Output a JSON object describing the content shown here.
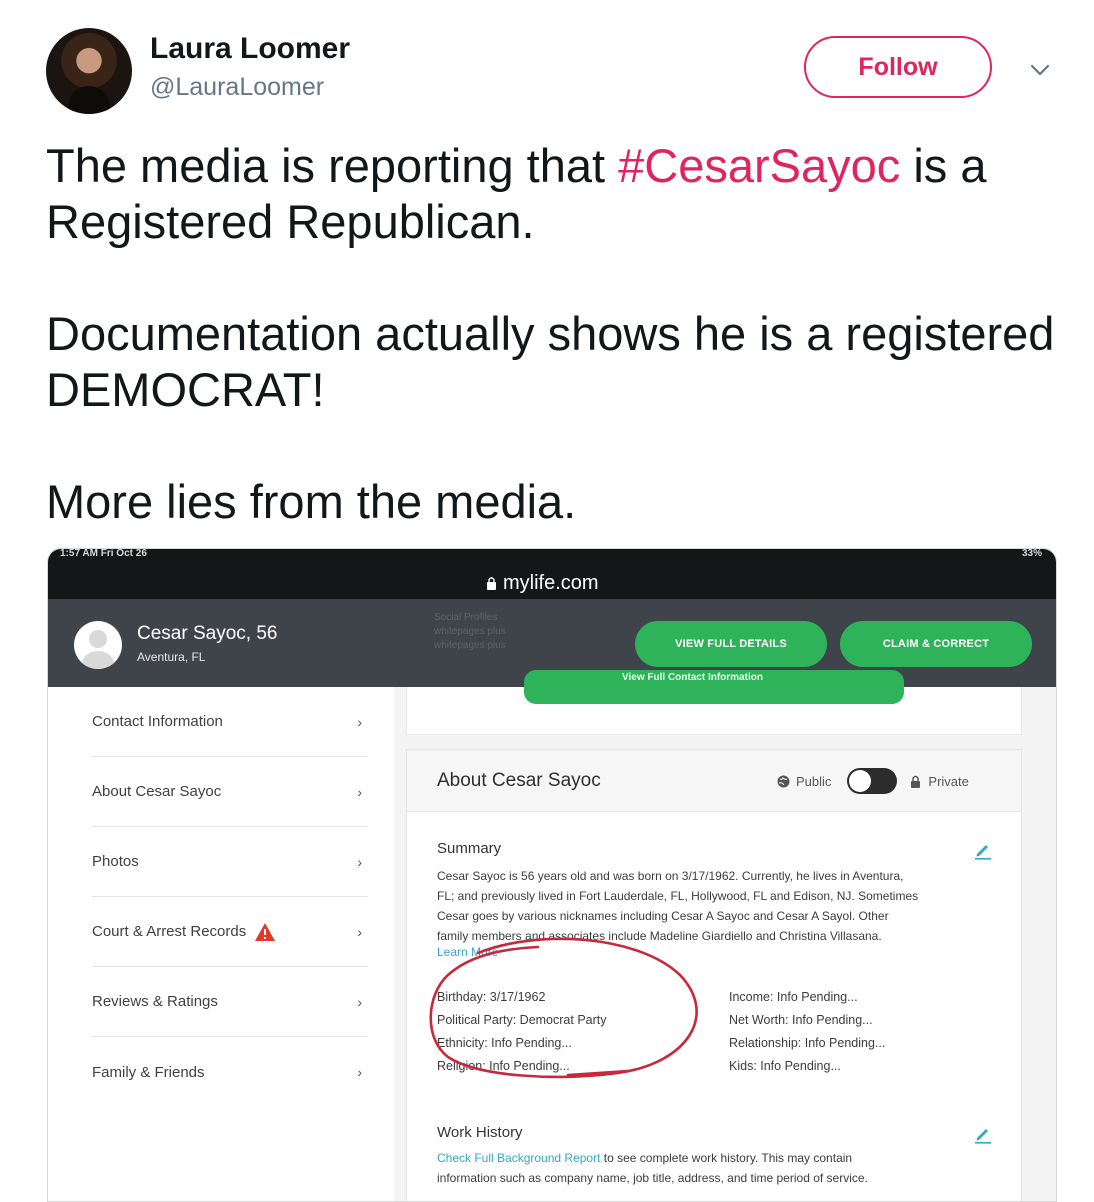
{
  "tweet": {
    "author_name": "Laura Loomer",
    "author_handle": "@LauraLoomer",
    "follow_label": "Follow",
    "text_line1_pre": "The media is reporting that ",
    "hashtag": "#CesarSayoc",
    "text_line1_post": " is a Registered Republican.",
    "text_para2": "Documentation actually shows he is a registered DEMOCRAT!",
    "text_para3": "More lies from the media."
  },
  "screenshot": {
    "status_left": "1:57 AM  Fri Oct 26",
    "status_right": "33%",
    "url": "mylife.com",
    "profile": {
      "name": "Cesar Sayoc, 56",
      "location": "Aventura, FL",
      "ghost_lines": [
        "Social Profiles",
        "whitepages plus",
        "whitepages plus"
      ]
    },
    "buttons": {
      "view_full_details": "VIEW FULL DETAILS",
      "claim_correct": "CLAIM & CORRECT",
      "view_contact": "View Full Contact Information"
    },
    "nav": [
      {
        "label": "Contact Information"
      },
      {
        "label": "About Cesar Sayoc"
      },
      {
        "label": "Photos"
      },
      {
        "label": "Court & Arrest Records"
      },
      {
        "label": "Reviews & Ratings"
      },
      {
        "label": "Family & Friends"
      }
    ],
    "nav_chevron": "›",
    "about": {
      "title": "About Cesar Sayoc",
      "public_label": "Public",
      "private_label": "Private",
      "summary_title": "Summary",
      "summary_lines": [
        "Cesar Sayoc is 56 years old and was born on 3/17/1962. Currently, he lives in Aventura,",
        "FL; and previously lived in Fort Lauderdale, FL, Hollywood, FL and Edison, NJ. Sometimes",
        "Cesar goes by various nicknames including Cesar A Sayoc and Cesar A Sayol. Other",
        "family members and associates include Madeline Giardiello and Christina Villasana."
      ],
      "learn_more": "Learn More",
      "facts_left": [
        "Birthday: 3/17/1962",
        "Political Party: Democrat Party",
        "Ethnicity: Info Pending...",
        "Religion: Info Pending..."
      ],
      "facts_right": [
        "Income: Info Pending...",
        "Net Worth: Info Pending...",
        "Relationship: Info Pending...",
        "Kids: Info Pending..."
      ],
      "work_title": "Work History",
      "work_link": "Check Full Background Report",
      "work_text_1": " to see complete work history. This may contain",
      "work_text_2": "information such as company name, job title, address, and time period of service."
    }
  },
  "colors": {
    "accent": "#e0245e",
    "green": "#2fb35a",
    "dark_header": "#3f444a",
    "link": "#35a7c5"
  }
}
